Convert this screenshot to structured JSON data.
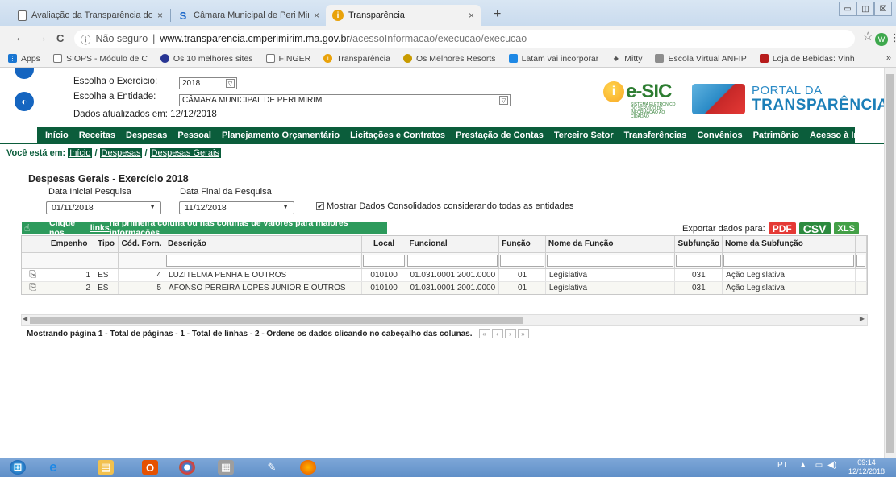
{
  "browser": {
    "tabs": [
      {
        "title": "Avaliação da Transparência dos ",
        "close": "×"
      },
      {
        "title": "Câmara Municipal de Peri Mirim",
        "close": "×"
      },
      {
        "title": "Transparência",
        "close": "×"
      }
    ],
    "new_tab": "+",
    "window_controls": [
      "▭",
      "◫",
      "☒"
    ],
    "nav": {
      "back": "←",
      "forward": "→",
      "reload": "C"
    },
    "security_label": "Não seguro",
    "url_host": "www.transparencia.cmperimirim.ma.gov.br",
    "url_path": "/acessoInformacao/execucao/execucao",
    "profile_initial": "W",
    "bookmarks": [
      {
        "label": "Apps",
        "icon": "apps-icon",
        "color": "#1976d2"
      },
      {
        "label": "SIOPS - Módulo de C",
        "icon": "page-icon",
        "color": "#777777"
      },
      {
        "label": "Os 10 melhores sites",
        "icon": "globe-icon",
        "color": "#283593"
      },
      {
        "label": "FINGER",
        "icon": "page-icon",
        "color": "#777777"
      },
      {
        "label": "Transparência",
        "icon": "info-icon",
        "color": "#e9a20a"
      },
      {
        "label": "Os Melhores Resorts",
        "icon": "tripadvisor-icon",
        "color": "#c89b00"
      },
      {
        "label": "Latam vai incorporar",
        "icon": "news-icon",
        "color": "#1e88e5"
      },
      {
        "label": "Mitty",
        "icon": "arrow-icon",
        "color": "#555555"
      },
      {
        "label": "Escola Virtual ANFIP",
        "icon": "school-icon",
        "color": "#8d8d8d"
      },
      {
        "label": "Loja de Bebidas: Vinh",
        "icon": "shop-icon",
        "color": "#b71c1c"
      }
    ],
    "bookmarks_overflow": "»"
  },
  "page": {
    "exercicio_label": "Escolha o Exercício:",
    "exercicio_value": "2018",
    "entidade_label": "Escolha a Entidade:",
    "entidade_value": "CÂMARA MUNICIPAL DE PERI MIRIM",
    "atualizados": "Dados atualizados em: 12/12/2018",
    "esic_text": "e-SIC",
    "esic_sub": "SISTEMA ELETRÔNICO DO SERVIÇO DE INFORMAÇÃO AO CIDADÃO",
    "portal_line1": "PORTAL DA",
    "portal_line2": "TRANSPARÊNCIA",
    "menu": [
      "Início",
      "Receitas",
      "Despesas",
      "Pessoal",
      "Planejamento Orçamentário",
      "Licitações e Contratos",
      "Prestação de Contas",
      "Terceiro Setor",
      "Transferências",
      "Convênios",
      "Patrimônio",
      "Acesso à Informação"
    ],
    "breadcrumb_prefix": "Você está em:",
    "breadcrumb": [
      "Início",
      "Despesas",
      "Despesas Gerais"
    ],
    "breadcrumb_sep": "/",
    "title": "Despesas Gerais - Exercício 2018",
    "data_inicial_label": "Data Inicial Pesquisa",
    "data_inicial": "01/11/2018",
    "data_final_label": "Data Final da Pesquisa",
    "data_final": "11/12/2018",
    "consolidado_label": "Mostrar Dados Consolidados considerando todas as entidades",
    "consolidado_checked": true,
    "info_pre": "Clique nos ",
    "info_link": "links",
    "info_post": " na primeira coluna ou nas colunas de valores para maiores informações.",
    "export_label": "Exportar dados para:",
    "export_formats": [
      "PDF",
      "CSV",
      "XLS"
    ]
  },
  "table": {
    "columns": [
      "",
      "Empenho",
      "Tipo",
      "Cód. Forn.",
      "Descrição",
      "Local",
      "Funcional",
      "Função",
      "Nome da Função",
      "Subfunção",
      "Nome da Subfunção",
      ""
    ],
    "rows": [
      [
        "",
        "1",
        "ES",
        "4",
        "LUZITELMA PENHA E OUTROS",
        "010100",
        "01.031.0001.2001.0000",
        "01",
        "Legislativa",
        "031",
        "Ação Legislativa"
      ],
      [
        "",
        "2",
        "ES",
        "5",
        "AFONSO PEREIRA LOPES JUNIOR E OUTROS",
        "010100",
        "01.031.0001.2001.0000",
        "01",
        "Legislativa",
        "031",
        "Ação Legislativa"
      ]
    ],
    "status": "Mostrando página 1 - Total de páginas - 1 - Total de linhas - 2 - Ordene os dados clicando no cabeçalho das colunas.",
    "pager": [
      "«",
      "‹",
      "›",
      "»"
    ]
  },
  "taskbar": {
    "lang": "PT",
    "time": "09:14",
    "date": "12/12/2018"
  },
  "colors": {
    "menu_green": "#0b5d3b",
    "info_green": "#2d9a5c",
    "pdf_red": "#e53935",
    "csv_green": "#2b8a3e"
  }
}
